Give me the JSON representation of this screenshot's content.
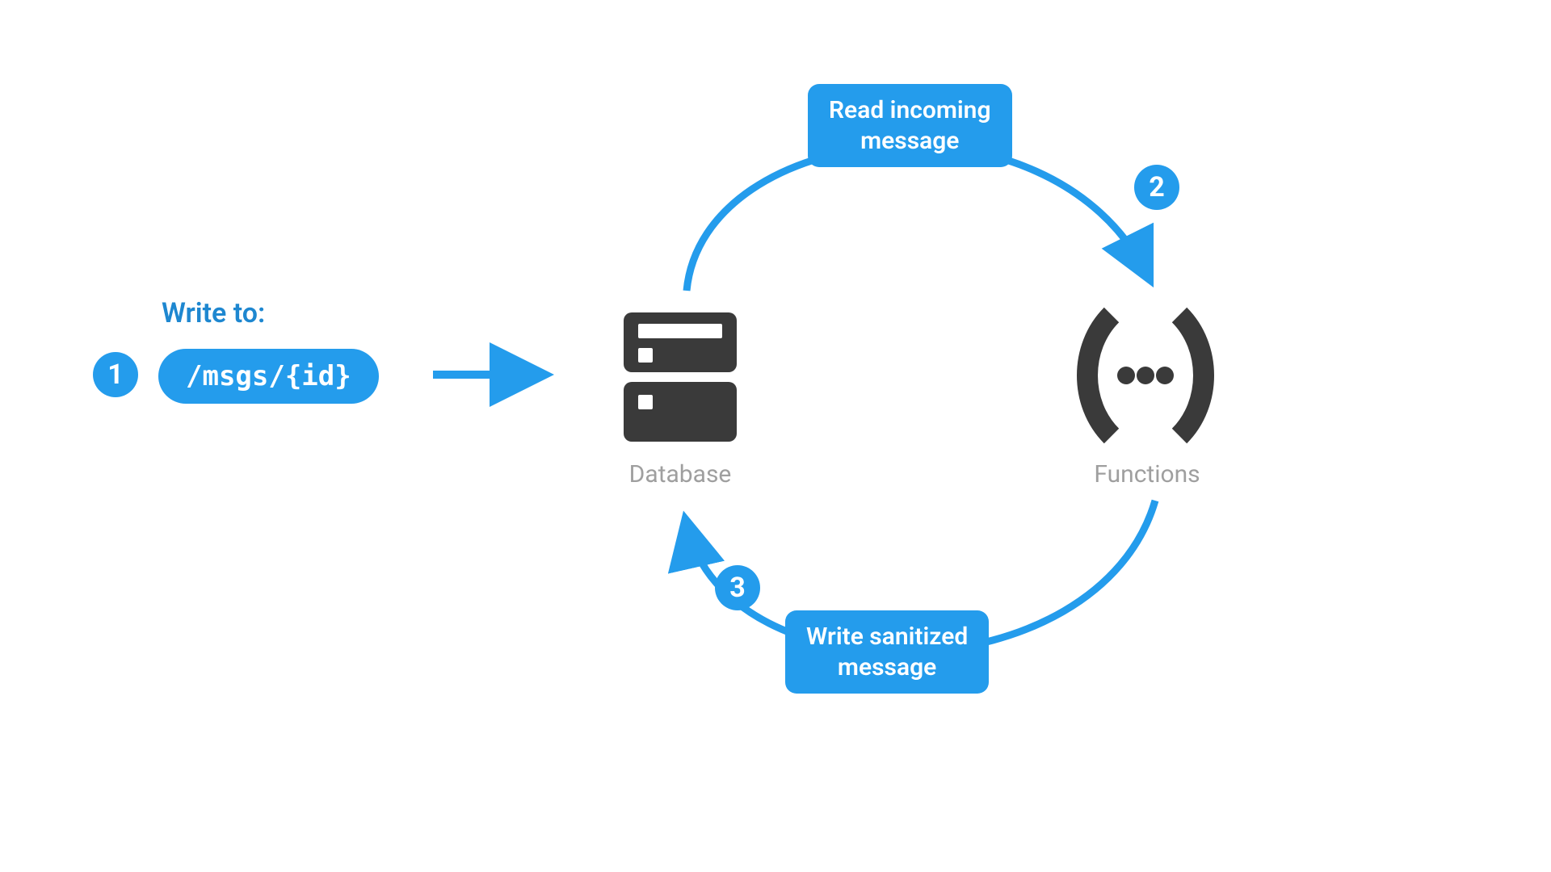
{
  "colors": {
    "accent": "#249cec",
    "heading": "#1e87d0",
    "node_dark": "#3a3a3a",
    "caption_gray": "#9f9f9f"
  },
  "write_section": {
    "heading": "Write to:",
    "path_pill": "/msgs/{id}"
  },
  "nodes": {
    "database_label": "Database",
    "functions_label": "Functions"
  },
  "steps": {
    "s1": "1",
    "s2": "2",
    "s3": "3"
  },
  "edge_labels": {
    "read_incoming": "Read incoming\nmessage",
    "write_sanitized": "Write sanitized\nmessage"
  },
  "icons": {
    "database": "server-icon",
    "functions": "brackets-ellipsis-icon"
  }
}
